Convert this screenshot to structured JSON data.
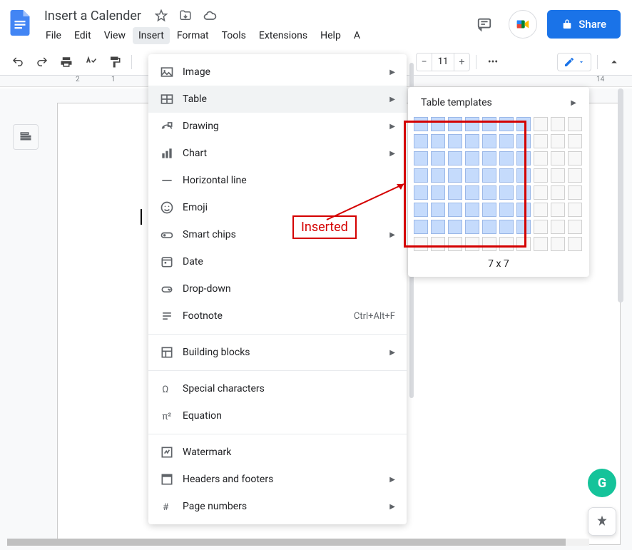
{
  "doc": {
    "title": "Insert a Calender"
  },
  "menubar": [
    "File",
    "Edit",
    "View",
    "Insert",
    "Format",
    "Tools",
    "Extensions",
    "Help",
    "A"
  ],
  "menubar_active_index": 3,
  "share_label": "Share",
  "toolbar": {
    "font_size": "11"
  },
  "insert_menu": [
    {
      "label": "Image",
      "arrow": true,
      "icon": "image"
    },
    {
      "label": "Table",
      "arrow": true,
      "hover": true,
      "icon": "table"
    },
    {
      "label": "Drawing",
      "arrow": true,
      "icon": "drawing"
    },
    {
      "label": "Chart",
      "arrow": true,
      "icon": "chart"
    },
    {
      "label": "Horizontal line",
      "icon": "hr"
    },
    {
      "label": "Emoji",
      "icon": "emoji"
    },
    {
      "label": "Smart chips",
      "arrow": true,
      "icon": "chip"
    },
    {
      "label": "Date",
      "icon": "date"
    },
    {
      "label": "Drop-down",
      "icon": "dropdown"
    },
    {
      "label": "Footnote",
      "shortcut": "Ctrl+Alt+F",
      "icon": "footnote"
    },
    {
      "sep": true
    },
    {
      "label": "Building blocks",
      "arrow": true,
      "icon": "blocks"
    },
    {
      "sep": true
    },
    {
      "label": "Special characters",
      "icon": "omega"
    },
    {
      "label": "Equation",
      "icon": "pi"
    },
    {
      "sep": true
    },
    {
      "label": "Watermark",
      "icon": "watermark"
    },
    {
      "label": "Headers and footers",
      "arrow": true,
      "icon": "header"
    },
    {
      "label": "Page numbers",
      "arrow": true,
      "icon": "hash"
    }
  ],
  "table_submenu": {
    "templates_label": "Table templates",
    "grid_rows": 8,
    "grid_cols": 10,
    "selected_rows": 7,
    "selected_cols": 7,
    "size_label": "7 x 7"
  },
  "annotation": {
    "label": "Inserted"
  },
  "ruler_marks": [
    "2",
    "1",
    "14"
  ]
}
